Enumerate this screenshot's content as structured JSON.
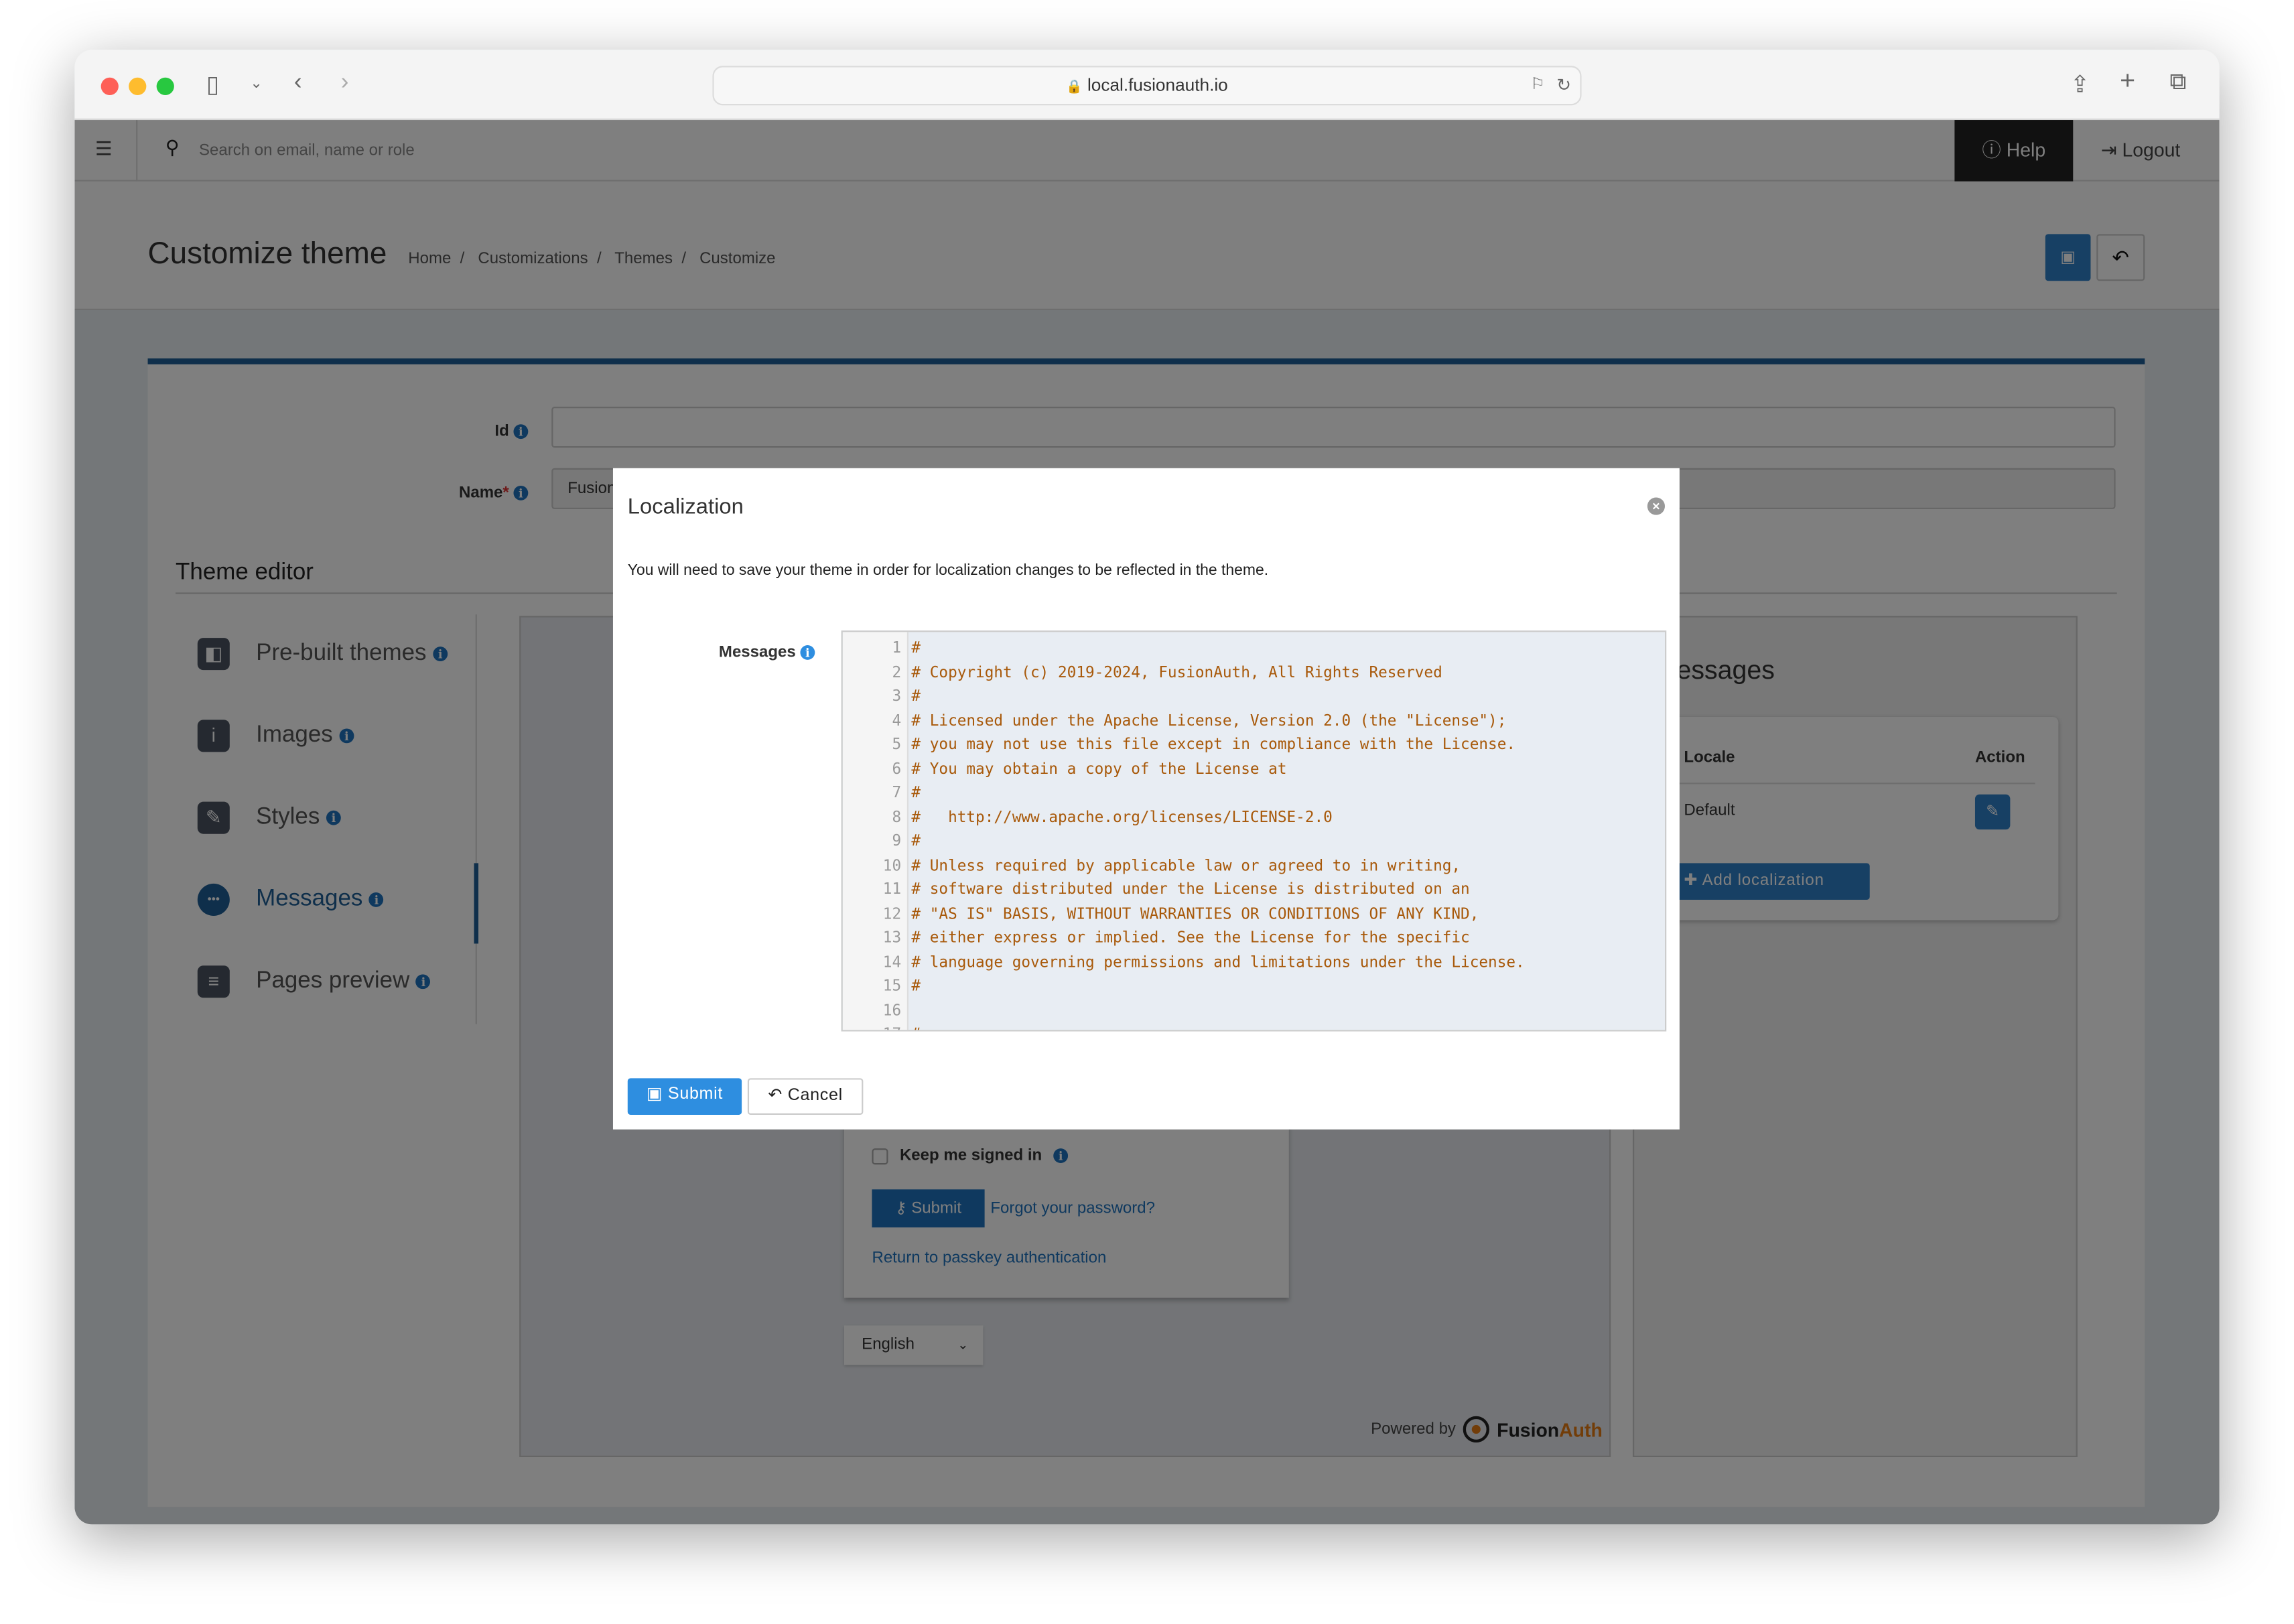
{
  "browser": {
    "url": "local.fusionauth.io"
  },
  "app_header": {
    "search_placeholder": "Search on email, name or role",
    "help_label": "Help",
    "logout_label": "Logout"
  },
  "page_header": {
    "title": "Customize theme",
    "breadcrumbs": [
      "Home",
      "Customizations",
      "Themes",
      "Customize"
    ]
  },
  "form": {
    "id_label": "Id",
    "id_value": "",
    "name_label": "Name",
    "name_required": "*",
    "name_value": "Fusion"
  },
  "theme_editor": {
    "title": "Theme editor",
    "items": [
      {
        "label": "Pre-built themes",
        "icon": "palette-icon",
        "active": false
      },
      {
        "label": "Images",
        "icon": "info-square-icon",
        "active": false
      },
      {
        "label": "Styles",
        "icon": "pencil-square-icon",
        "active": false
      },
      {
        "label": "Messages",
        "icon": "comment-dots-icon",
        "active": true
      },
      {
        "label": "Pages preview",
        "icon": "file-lines-icon",
        "active": false
      }
    ]
  },
  "preview": {
    "keep_signed_in": "Keep me signed in",
    "submit": "Submit",
    "forgot": "Forgot your password?",
    "return_passkey": "Return to passkey authentication",
    "language": "English",
    "powered_by": "Powered by",
    "brand_fusion": "Fusion",
    "brand_auth": "Auth"
  },
  "messages_panel": {
    "heading": "Messages",
    "col_locale": "Locale",
    "col_action": "Action",
    "rows": [
      {
        "locale": "Default"
      }
    ],
    "add_button": "Add localization"
  },
  "modal": {
    "title": "Localization",
    "notice": "You will need to save your theme in order for localization changes to be reflected in the theme.",
    "messages_label": "Messages",
    "code_lines": [
      "#",
      "# Copyright (c) 2019-2024, FusionAuth, All Rights Reserved",
      "#",
      "# Licensed under the Apache License, Version 2.0 (the \"License\");",
      "# you may not use this file except in compliance with the License.",
      "# You may obtain a copy of the License at",
      "#",
      "#   http://www.apache.org/licenses/LICENSE-2.0",
      "#",
      "# Unless required by applicable law or agreed to in writing,",
      "# software distributed under the License is distributed on an",
      "# \"AS IS\" BASIS, WITHOUT WARRANTIES OR CONDITIONS OF ANY KIND,",
      "# either express or implied. See the License for the specific",
      "# language governing permissions and limitations under the License.",
      "#",
      "",
      "#"
    ],
    "submit_label": "Submit",
    "cancel_label": "Cancel"
  },
  "colors": {
    "primary": "#1e5f96",
    "modal_submit": "#2e8ee0",
    "code_text": "#a8590a",
    "code_bg": "#e8edf3",
    "brand_orange": "#e57b12"
  }
}
